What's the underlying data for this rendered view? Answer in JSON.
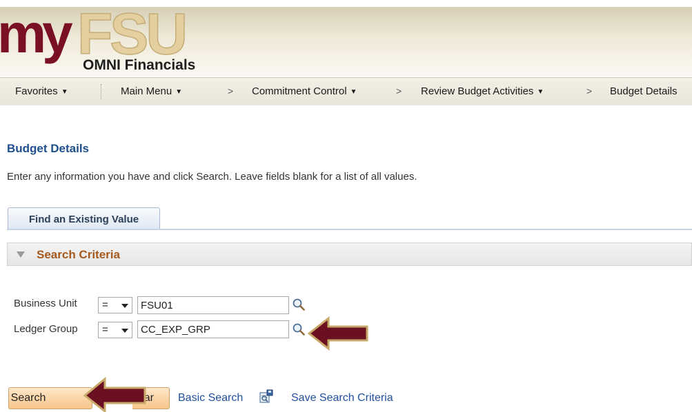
{
  "header": {
    "logo_text": "myFSU",
    "app_title": "OMNI Financials"
  },
  "nav": {
    "favorites": "Favorites",
    "main_menu": "Main Menu",
    "commitment_control": "Commitment Control",
    "review_budget": "Review Budget Activities",
    "budget_details": "Budget Details",
    "separator": ">"
  },
  "page": {
    "title": "Budget Details",
    "instructions": "Enter any information you have and click Search. Leave fields blank for a list of all values."
  },
  "tabs": [
    {
      "label": "Find an Existing Value"
    }
  ],
  "search_criteria": {
    "label": "Search Criteria"
  },
  "fields": [
    {
      "label": "Business Unit",
      "operator": "=",
      "value": "FSU01"
    },
    {
      "label": "Ledger Group",
      "operator": "=",
      "value": "CC_EXP_GRP"
    }
  ],
  "buttons": {
    "search": "Search",
    "clear": "ar",
    "basic_search": "Basic Search",
    "save_search": "Save Search Criteria"
  },
  "colors": {
    "title_blue": "#1f4f8c",
    "criteria_orange": "#a5591e",
    "link_blue": "#1f4f9e",
    "arrow_maroon": "#6b1020",
    "arrow_gold": "#c9a96a"
  }
}
